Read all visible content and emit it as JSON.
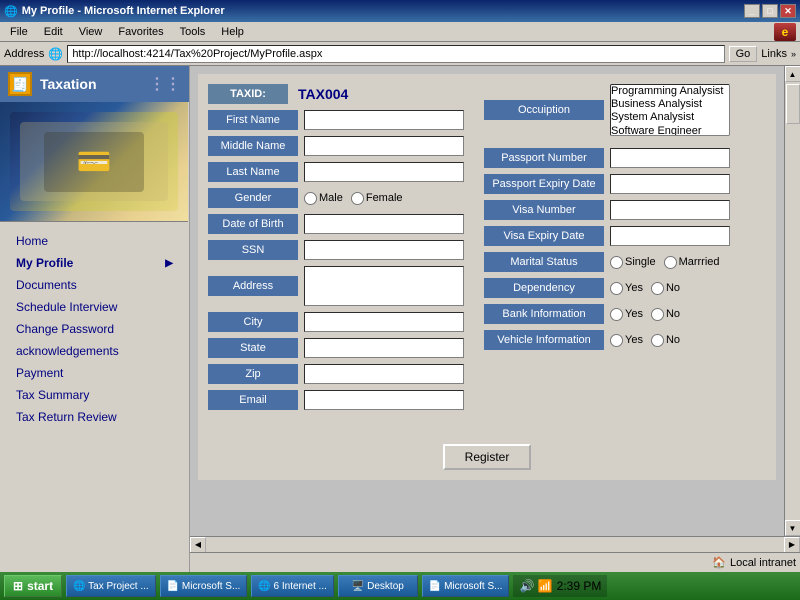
{
  "titlebar": {
    "title": "My Profile - Microsoft Internet Explorer",
    "icon": "🌐",
    "controls": [
      "_",
      "□",
      "✕"
    ]
  },
  "menubar": {
    "items": [
      "File",
      "Edit",
      "View",
      "Favorites",
      "Tools",
      "Help"
    ]
  },
  "addressbar": {
    "label": "Address",
    "url": "http://localhost:4214/Tax%20Project/MyProfile.aspx",
    "go_label": "Go",
    "links_label": "Links"
  },
  "sidebar": {
    "app_name": "Taxation",
    "nav_items": [
      {
        "label": "Home",
        "has_arrow": false
      },
      {
        "label": "My Profile",
        "has_arrow": true,
        "active": true
      },
      {
        "label": "Documents",
        "has_arrow": false
      },
      {
        "label": "Schedule Interview",
        "has_arrow": false
      },
      {
        "label": "Change Password",
        "has_arrow": false
      },
      {
        "label": "acknowledgements",
        "has_arrow": false
      },
      {
        "label": "Payment",
        "has_arrow": false
      },
      {
        "label": "Tax Summary",
        "has_arrow": false
      },
      {
        "label": "Tax Return Review",
        "has_arrow": false
      }
    ]
  },
  "form": {
    "taxid_label": "TAXID:",
    "taxid_value": "TAX004",
    "fields": [
      {
        "label": "First Name",
        "type": "text",
        "value": ""
      },
      {
        "label": "Middle Name",
        "type": "text",
        "value": ""
      },
      {
        "label": "Last Name",
        "type": "text",
        "value": ""
      },
      {
        "label": "Gender",
        "type": "radio",
        "options": [
          "Male",
          "Female"
        ]
      },
      {
        "label": "Date of Birth",
        "type": "text",
        "value": ""
      },
      {
        "label": "SSN",
        "type": "text",
        "value": ""
      },
      {
        "label": "Address",
        "type": "textarea",
        "value": ""
      },
      {
        "label": "City",
        "type": "text",
        "value": ""
      },
      {
        "label": "State",
        "type": "text",
        "value": ""
      },
      {
        "label": "Zip",
        "type": "text",
        "value": ""
      },
      {
        "label": "Email",
        "type": "text",
        "value": ""
      }
    ],
    "right_fields": [
      {
        "label": "Passport Number",
        "type": "text",
        "value": ""
      },
      {
        "label": "Passport Expiry Date",
        "type": "text",
        "value": ""
      },
      {
        "label": "Visa Number",
        "type": "text",
        "value": ""
      },
      {
        "label": "Visa Expiry Date",
        "type": "text",
        "value": ""
      },
      {
        "label": "Marital Status",
        "type": "radio",
        "options": [
          "Single",
          "Marrried"
        ]
      },
      {
        "label": "Dependency",
        "type": "radio",
        "options": [
          "Yes",
          "No"
        ]
      },
      {
        "label": "Bank Information",
        "type": "radio",
        "options": [
          "Yes",
          "No"
        ]
      },
      {
        "label": "Vehicle Information",
        "type": "radio",
        "options": [
          "Yes",
          "No"
        ]
      }
    ],
    "occupation_label": "Occuiption",
    "occupation_options": [
      "Programming Analysist",
      "Business Analysist",
      "System Analysist",
      "Software Engineer"
    ],
    "register_label": "Register"
  },
  "statusbar": {
    "message": "",
    "zone": "Local intranet",
    "zone_icon": "🏠"
  },
  "taskbar": {
    "start_label": "start",
    "tasks": [
      "Tax Project ...",
      "Microsoft S...",
      "6 Internet ...",
      "Desktop",
      "Microsoft S..."
    ],
    "time": "2:39 PM"
  }
}
